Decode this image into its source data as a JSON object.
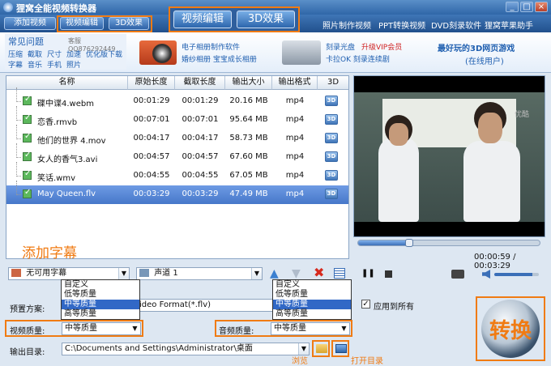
{
  "window": {
    "title": "狸窝全能视频转换器",
    "controls": [
      "_",
      "□",
      "×"
    ]
  },
  "menubar": {
    "buttons": [
      "添加视频",
      "视频编辑",
      "3D效果"
    ],
    "big_buttons": [
      "视频编辑",
      "3D效果"
    ],
    "links": [
      "照片制作视频",
      "PPT转换视频",
      "DVD刻录软件",
      "狸窝苹果助手"
    ]
  },
  "adbar": {
    "faq_title": "常见问题",
    "qq": "客服QQ876292449",
    "faq_links_row1": [
      "压缩",
      "截取",
      "尺寸",
      "加速",
      "优化版下载"
    ],
    "faq_links_row2": [
      "字幕",
      "音乐",
      "手机",
      "照片"
    ],
    "ad1_line1": "电子相册制作软件",
    "ad1_line2": "婚纱相册  宝宝成长相册",
    "ad2_line1": "刻录光盘",
    "ad2_vip": "升级VIP会员",
    "ad2_line2": "卡拉OK  刻录连续剧",
    "ad3_line1": "最好玩的3D网页游戏",
    "ad3_line2": "(在线用户)"
  },
  "grid": {
    "headers": [
      "名称",
      "原始长度",
      "截取长度",
      "输出大小",
      "输出格式",
      "3D"
    ],
    "badge": "3D",
    "rows": [
      {
        "name": "碟中谍4.webm",
        "orig": "00:01:29",
        "cut": "00:01:29",
        "size": "20.16 MB",
        "fmt": "mp4"
      },
      {
        "name": "恋香.rmvb",
        "orig": "00:07:01",
        "cut": "00:07:01",
        "size": "95.64 MB",
        "fmt": "mp4"
      },
      {
        "name": "他们的世界 4.mov",
        "orig": "00:04:17",
        "cut": "00:04:17",
        "size": "58.73 MB",
        "fmt": "mp4"
      },
      {
        "name": "女人的香气3.avi",
        "orig": "00:04:57",
        "cut": "00:04:57",
        "size": "67.60 MB",
        "fmt": "mp4"
      },
      {
        "name": "笑话.wmv",
        "orig": "00:04:55",
        "cut": "00:04:55",
        "size": "67.05 MB",
        "fmt": "mp4"
      },
      {
        "name": "May Queen.flv",
        "orig": "00:03:29",
        "cut": "00:03:29",
        "size": "47.49 MB",
        "fmt": "mp4"
      }
    ],
    "selected_row": 5
  },
  "preview": {
    "watermark": "优酷",
    "progress": 0.28,
    "time": "00:00:59 / 00:03:29"
  },
  "subtitle": {
    "annotation": "添加字幕",
    "value": "无可用字幕"
  },
  "audio_track": {
    "value": "声道 1"
  },
  "quality_options": [
    "自定义",
    "低等质量",
    "中等质量",
    "高等质量"
  ],
  "quality_highlight": 2,
  "preset": {
    "label": "预置方案:",
    "value": "ideo Format(*.flv)"
  },
  "apply_all": "应用到所有",
  "video_quality": {
    "label": "视频质量:",
    "value": "中等质量"
  },
  "audio_quality": {
    "label": "音频质量:",
    "value": "中等质量"
  },
  "output": {
    "label": "输出目录:",
    "path": "C:\\Documents and Settings\\Administrator\\桌面",
    "browse": "浏览",
    "open": "打开目录"
  },
  "convert_label": "转换",
  "colors": {
    "accent": "#f07b13",
    "titlebar": "#2f66a8",
    "selection": "#4677c9"
  }
}
